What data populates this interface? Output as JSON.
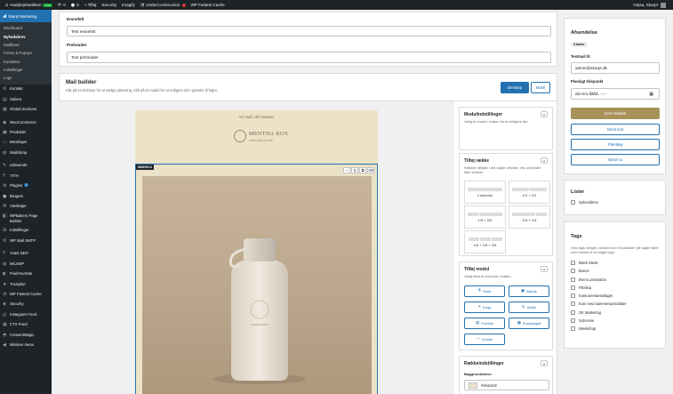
{
  "adminbar": {
    "site": "Hudplejebutikken",
    "live": "Live",
    "comments_count": "0",
    "updates_count": "0",
    "new": "+ Tilføj",
    "items": [
      "Security",
      "Imagify",
      "UnderConstruction",
      "WP Fastest Cache"
    ],
    "greeting": "Hejsa, Skarpt"
  },
  "sidebar": {
    "current": "Skarpt Marketing",
    "sub": [
      "Dashboard",
      "Nyhedsbrev",
      "Mailflows",
      "Forms & Popups",
      "Kontakter",
      "Indstillinger",
      "Logs"
    ],
    "active_sub": "Nyhedsbrev",
    "items": [
      {
        "icon": "envelope-icon",
        "glyph": "✉",
        "label": "Kontakt"
      },
      {
        "icon": "slider-icon",
        "glyph": "▤",
        "label": "Salient"
      },
      {
        "icon": "sections-icon",
        "glyph": "▦",
        "label": "Global Sections"
      },
      {
        "icon": "woocommerce-icon",
        "glyph": "◉",
        "label": "WooCommerce"
      },
      {
        "icon": "products-icon",
        "glyph": "▣",
        "label": "Produkter"
      },
      {
        "icon": "payments-icon",
        "glyph": "▭",
        "label": "Betalinger"
      },
      {
        "icon": "mailchimp-icon",
        "glyph": "◍",
        "label": "Mailchimp"
      },
      {
        "icon": "appearance-icon",
        "glyph": "✎",
        "label": "Udseende"
      },
      {
        "icon": "yith-icon",
        "glyph": "Y",
        "label": "YITH"
      },
      {
        "icon": "plugins-icon",
        "glyph": "⚙",
        "label": "Plugins",
        "badge": "1"
      },
      {
        "icon": "users-icon",
        "glyph": "●",
        "label": "Brugere"
      },
      {
        "icon": "tools-icon",
        "glyph": "⚒",
        "label": "Værktøjer"
      },
      {
        "icon": "wpbakery-icon",
        "glyph": "◧",
        "label": "WPBakery Page Builder"
      },
      {
        "icon": "settings-icon",
        "glyph": "⊞",
        "label": "Indstillinger"
      },
      {
        "icon": "wpmail-icon",
        "glyph": "✉",
        "label": "WP Mail SMTP"
      },
      {
        "icon": "yoast-icon",
        "glyph": "Y",
        "label": "Yoast SEO"
      },
      {
        "icon": "mc4wp-icon",
        "glyph": "◍",
        "label": "MC4WP"
      },
      {
        "icon": "pixelyoursite-icon",
        "glyph": "◐",
        "label": "PixelYourSite"
      },
      {
        "icon": "trustpilot-icon",
        "glyph": "★",
        "label": "Trustpilot"
      },
      {
        "icon": "wpfastest-icon",
        "glyph": "◔",
        "label": "WP Fastest Cache"
      },
      {
        "icon": "security-icon",
        "glyph": "◈",
        "label": "Security"
      },
      {
        "icon": "instagram-icon",
        "glyph": "◎",
        "label": "Instagram Feed"
      },
      {
        "icon": "ctx-icon",
        "glyph": "▦",
        "label": "CTX Feed"
      },
      {
        "icon": "consentmagic-icon",
        "glyph": "◓",
        "label": "ConsentMagic"
      },
      {
        "icon": "collapse-icon",
        "glyph": "◀",
        "label": "Minimer menu"
      }
    ]
  },
  "fields": {
    "subject_label": "Emnefelt",
    "subject_value": "Test emnefelt",
    "preheader_label": "Preheader",
    "preheader_value": "Test preheader"
  },
  "builder": {
    "title": "Mail builder",
    "desc": "Klik på en kolonne for at vælge placering. Klik på et modul for at redigere det i panelet til højre.",
    "desktop": "Desktop",
    "mobil": "Mobil",
    "preview_text": "Vis mail i din browser",
    "logo_brand": "MENTHA BOX",
    "logo_sub": "SKINCARE HOUSE",
    "column_tag": "INDHOLD",
    "tools": [
      "+",
      "⇅",
      "⧉",
      "⌫"
    ]
  },
  "module_settings": {
    "title": "Modulindstillinger",
    "text": "Vælg et modul i mailen for at redigere det."
  },
  "add_row": {
    "title": "Tilføj række",
    "text": "Rækken tilføjes i det valgte område, nej, indholdet efter blokker.",
    "layouts": [
      "1 kolonne",
      "1/2 + 1/2",
      "1/3 + 2/3",
      "2/3 + 1/3",
      "1/3 + 1/3 + 1/3"
    ]
  },
  "add_module": {
    "title": "Tilføj modul",
    "text": "Vælg først en kolonne i mailen.",
    "modules": [
      {
        "icon": "paragraph-icon",
        "glyph": "¶",
        "label": "Tekst"
      },
      {
        "icon": "image-icon",
        "glyph": "▣",
        "label": "Billede"
      },
      {
        "icon": "link-icon",
        "glyph": "⚭",
        "label": "Knap"
      },
      {
        "icon": "share-icon",
        "glyph": "⇆",
        "label": "SoMe"
      },
      {
        "icon": "product-icon",
        "glyph": "▤",
        "label": "Produkt"
      },
      {
        "icon": "products-grid-icon",
        "glyph": "▦",
        "label": "Produktgrid"
      },
      {
        "icon": "divider-icon",
        "glyph": "—",
        "label": "Divider"
      }
    ]
  },
  "row_settings": {
    "title": "Rækkeindstillinger",
    "bg_label": "Baggrundsfarve",
    "bg_value": "#ebe2c8"
  },
  "colors": {
    "bg_swatch": "#ebe2c8",
    "primary": "#2271b1",
    "send_now": "#a8925a"
  },
  "send": {
    "title": "Afsendelse",
    "status": "Kladde",
    "test_label": "Testmail til",
    "test_value": "admin@skarpt.dk",
    "planned_label": "Planlagt tidspunkt",
    "planned_value": "dd.mm.åååå, --.--",
    "save_draft": "Gem Kladde",
    "send_test": "Send test",
    "schedule": "Planlæg",
    "send_now": "Send nu"
  },
  "lists": {
    "title": "Lister",
    "items": [
      "Nyhedsbrev"
    ]
  },
  "tags": {
    "title": "Tags",
    "text": "Hvis tags vælges, sendes kun til kontakter på valgte lister med mindst et af valgte tags.",
    "items": [
      "Black Week",
      "Bonus",
      "Brent Lamination",
      "Filtelina",
      "Kontourenaesarlager",
      "Kom med sammensprodukter",
      "OK Marketing",
      "Solcreme",
      "Weekshop"
    ]
  }
}
